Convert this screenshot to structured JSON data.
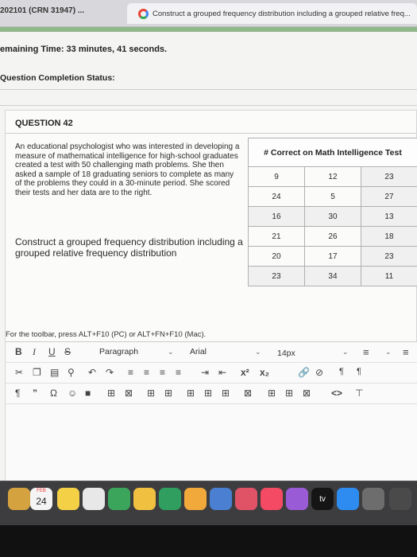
{
  "browser": {
    "left_tab": "202101 (CRN 31947) ...",
    "active_tab": "Construct a grouped frequency distribution including a grouped relative freq..."
  },
  "header": {
    "timer_label": "emaining Time:",
    "timer_value": "33 minutes, 41 seconds.",
    "completion_label": "Question Completion Status:"
  },
  "question": {
    "number": "QUESTION 42",
    "prompt": "An educational psychologist who was interested in developing a measure of mathematical intelligence for high-school graduates created a test with 50 challenging math problems. She then asked a sample of 18 graduating seniors to complete as many of the problems they could in a 30-minute period. She scored their tests and her data are to the right.",
    "task": "Construct a grouped frequency distribution including a grouped relative frequency distribution",
    "table_header": "# Correct on Math Intelligence Test",
    "table_rows": [
      [
        "9",
        "12",
        "23"
      ],
      [
        "24",
        "5",
        "27"
      ],
      [
        "16",
        "30",
        "13"
      ],
      [
        "21",
        "26",
        "18"
      ],
      [
        "20",
        "17",
        "23"
      ],
      [
        "23",
        "34",
        "11"
      ]
    ]
  },
  "editor": {
    "hint": "For the toolbar, press ALT+F10 (PC) or ALT+FN+F10 (Mac).",
    "bold": "B",
    "italic": "I",
    "underline": "U",
    "strike": "S",
    "paragraph": "Paragraph",
    "font": "Arial",
    "size": "14px"
  },
  "dock": {
    "calendar_month": "FEB",
    "calendar_day": "24",
    "tv_label": "tv"
  },
  "colors": {
    "accent_green": "#8fb88a",
    "dock_bg": "#3d3d40"
  }
}
